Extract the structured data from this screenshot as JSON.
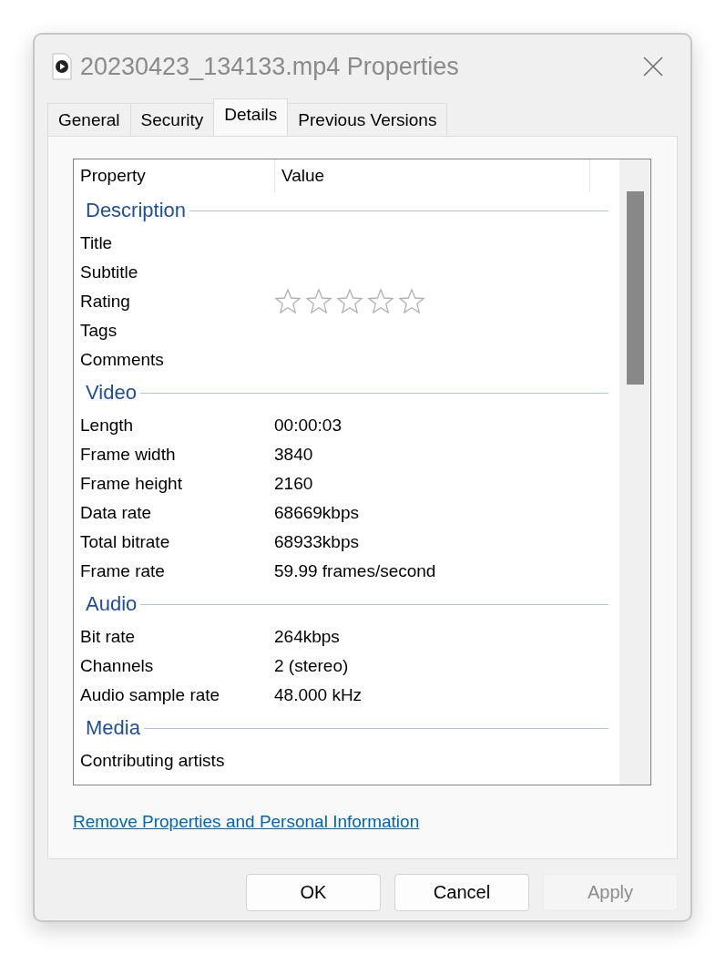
{
  "window": {
    "title": "20230423_134133.mp4 Properties"
  },
  "tabs": [
    {
      "label": "General",
      "selected": false
    },
    {
      "label": "Security",
      "selected": false
    },
    {
      "label": "Details",
      "selected": true
    },
    {
      "label": "Previous Versions",
      "selected": false
    }
  ],
  "list": {
    "columns": [
      "Property",
      "Value"
    ],
    "groups": [
      {
        "title": "Description",
        "rows": [
          {
            "kind": "text",
            "property": "Title"
          },
          {
            "kind": "text",
            "property": "Subtitle"
          },
          {
            "kind": "rating",
            "property": "Rating",
            "stars": 0
          },
          {
            "kind": "text",
            "property": "Tags"
          },
          {
            "kind": "text",
            "property": "Comments"
          }
        ]
      },
      {
        "title": "Video",
        "rows": [
          {
            "kind": "text",
            "property": "Length",
            "value": "00:00:03"
          },
          {
            "kind": "text",
            "property": "Frame width",
            "value": "3840"
          },
          {
            "kind": "text",
            "property": "Frame height",
            "value": "2160"
          },
          {
            "kind": "text",
            "property": "Data rate",
            "value": "68669kbps"
          },
          {
            "kind": "text",
            "property": "Total bitrate",
            "value": "68933kbps"
          },
          {
            "kind": "text",
            "property": "Frame rate",
            "value": "59.99 frames/second"
          }
        ]
      },
      {
        "title": "Audio",
        "rows": [
          {
            "kind": "text",
            "property": "Bit rate",
            "value": "264kbps"
          },
          {
            "kind": "text",
            "property": "Channels",
            "value": "2 (stereo)"
          },
          {
            "kind": "text",
            "property": "Audio sample rate",
            "value": "48.000 kHz"
          }
        ]
      },
      {
        "title": "Media",
        "rows": [
          {
            "kind": "text",
            "property": "Contributing artists"
          }
        ]
      }
    ]
  },
  "link": "Remove Properties and Personal Information",
  "buttons": [
    {
      "label": "OK",
      "disabled": false
    },
    {
      "label": "Cancel",
      "disabled": false
    },
    {
      "label": "Apply",
      "disabled": true
    }
  ]
}
